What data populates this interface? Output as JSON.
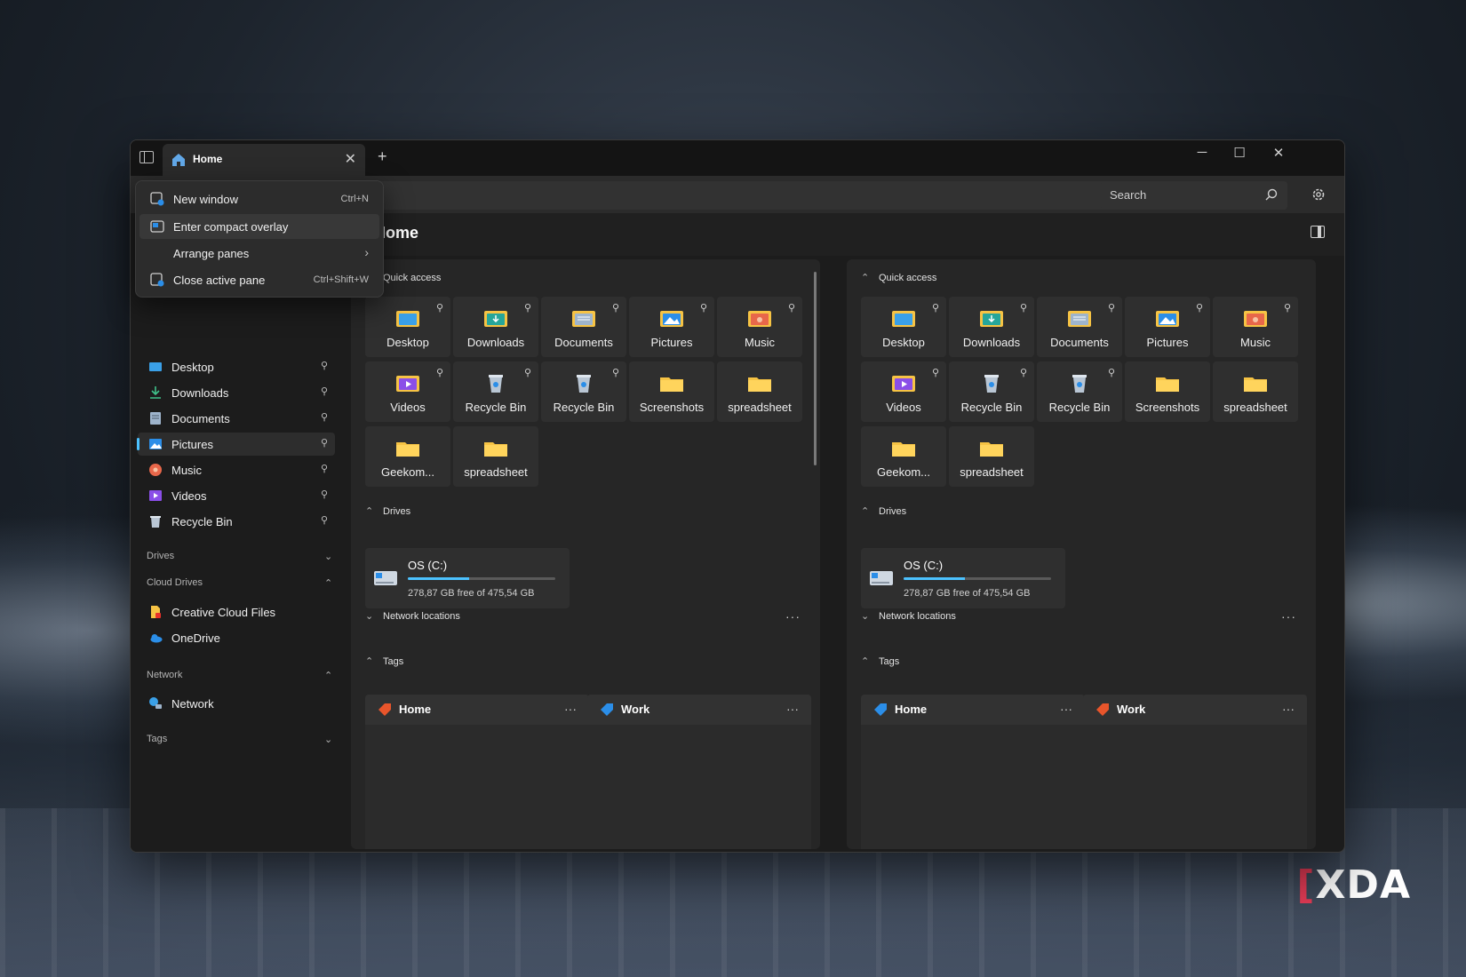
{
  "tab": {
    "label": "Home",
    "close": "✕",
    "new_tab": "+"
  },
  "window_controls": {
    "minimize": "─",
    "maximize": "☐",
    "close": "✕"
  },
  "address": {
    "chevron": "⌄"
  },
  "search": {
    "placeholder": "Search"
  },
  "header": {
    "title": "Home"
  },
  "menu": {
    "items": [
      {
        "label": "New window",
        "shortcut": "Ctrl+N"
      },
      {
        "label": "Enter compact overlay",
        "shortcut": ""
      },
      {
        "label": "Arrange panes",
        "shortcut": "›"
      },
      {
        "label": "Close active pane",
        "shortcut": "Ctrl+Shift+W"
      }
    ]
  },
  "sidebar": {
    "items": [
      {
        "label": "Desktop",
        "icon": "desktop-icon"
      },
      {
        "label": "Downloads",
        "icon": "downloads-icon"
      },
      {
        "label": "Documents",
        "icon": "documents-icon"
      },
      {
        "label": "Pictures",
        "icon": "pictures-icon",
        "selected": true
      },
      {
        "label": "Music",
        "icon": "music-icon"
      },
      {
        "label": "Videos",
        "icon": "videos-icon"
      },
      {
        "label": "Recycle Bin",
        "icon": "recycle-bin-icon"
      }
    ],
    "sections": {
      "drives": "Drives",
      "cloud_drives": "Cloud Drives",
      "network": "Network",
      "tags": "Tags"
    },
    "cloud_items": [
      {
        "label": "Creative Cloud Files",
        "icon": "creative-cloud-icon"
      },
      {
        "label": "OneDrive",
        "icon": "onedrive-icon"
      }
    ],
    "network_items": [
      {
        "label": "Network",
        "icon": "network-icon"
      }
    ],
    "pin": "⚲"
  },
  "pane": {
    "quick_access_label": "Quick access",
    "drives_label": "Drives",
    "network_label": "Network locations",
    "tags_label": "Tags",
    "more": "···",
    "tiles": [
      {
        "label": "Desktop",
        "pinned": true,
        "icon": "desktop-folder-icon"
      },
      {
        "label": "Downloads",
        "pinned": true,
        "icon": "downloads-folder-icon"
      },
      {
        "label": "Documents",
        "pinned": true,
        "icon": "documents-folder-icon"
      },
      {
        "label": "Pictures",
        "pinned": true,
        "icon": "pictures-folder-icon"
      },
      {
        "label": "Music",
        "pinned": true,
        "icon": "music-folder-icon"
      },
      {
        "label": "Videos",
        "pinned": true,
        "icon": "videos-folder-icon"
      },
      {
        "label": "Recycle Bin",
        "pinned": true,
        "icon": "recycle-bin-icon"
      },
      {
        "label": "Recycle Bin",
        "pinned": true,
        "icon": "recycle-bin-icon"
      },
      {
        "label": "Screenshots",
        "pinned": false,
        "icon": "folder-icon"
      },
      {
        "label": "spreadsheet",
        "pinned": false,
        "icon": "folder-icon"
      },
      {
        "label": "Geekom...",
        "pinned": false,
        "icon": "folder-icon"
      },
      {
        "label": "spreadsheet",
        "pinned": false,
        "icon": "folder-icon"
      }
    ],
    "drive": {
      "name": "OS (C:)",
      "free": "278,87 GB free of 475,54 GB",
      "used_fraction": 0.414
    },
    "left_tags": [
      {
        "name": "Home",
        "color": "#e8552b"
      },
      {
        "name": "Work",
        "color": "#2b8ee8"
      }
    ],
    "right_tags": [
      {
        "name": "Home",
        "color": "#2b8ee8"
      },
      {
        "name": "Work",
        "color": "#e8552b"
      }
    ]
  },
  "watermark": {
    "bracket": "[",
    "text": "XDA"
  },
  "colors": {
    "accent": "#4cc2ff",
    "folder": "#f6c344",
    "window_bg": "#1c1c1c"
  }
}
